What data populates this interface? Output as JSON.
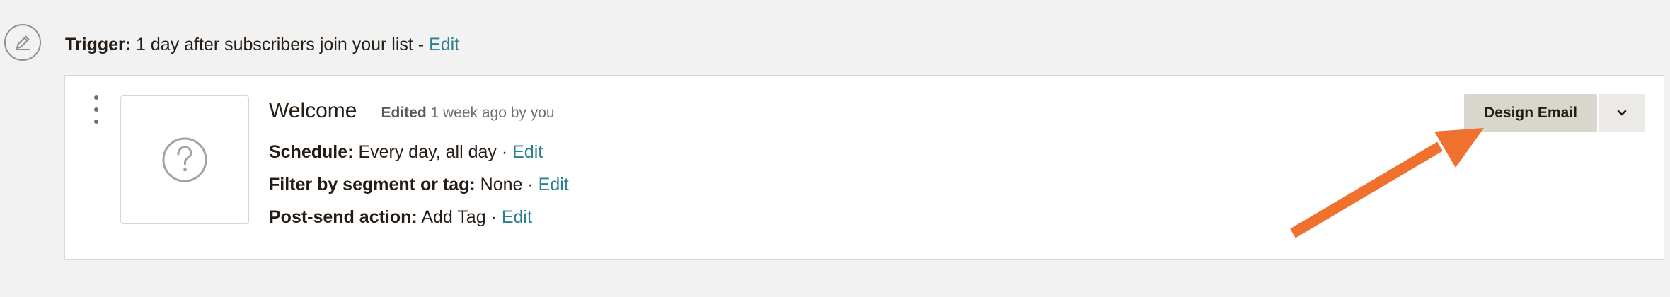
{
  "trigger": {
    "icon": "pencil-icon",
    "label": "Trigger:",
    "text": "1 day after subscribers join your list -",
    "edit_link": "Edit"
  },
  "email_card": {
    "menu_icon": "vertical-ellipsis-icon",
    "thumbnail_icon": "question-mark-icon",
    "title": "Welcome",
    "edited_label": "Edited",
    "edited_text": "1 week ago by you",
    "schedule": {
      "label": "Schedule:",
      "value": "Every day, all day ·",
      "edit_link": "Edit"
    },
    "filter": {
      "label": "Filter by segment or tag:",
      "value": "None ·",
      "edit_link": "Edit"
    },
    "post_send": {
      "label": "Post-send action:",
      "value": "Add Tag ·",
      "edit_link": "Edit"
    },
    "design_button_label": "Design Email",
    "dropdown_icon": "chevron-down-icon"
  },
  "annotation": {
    "icon": "arrow-annotation-icon",
    "color": "#f0702e"
  },
  "colors": {
    "link": "#2c7f8f",
    "background": "#f2f2f2",
    "button": "#d9d6cd"
  }
}
